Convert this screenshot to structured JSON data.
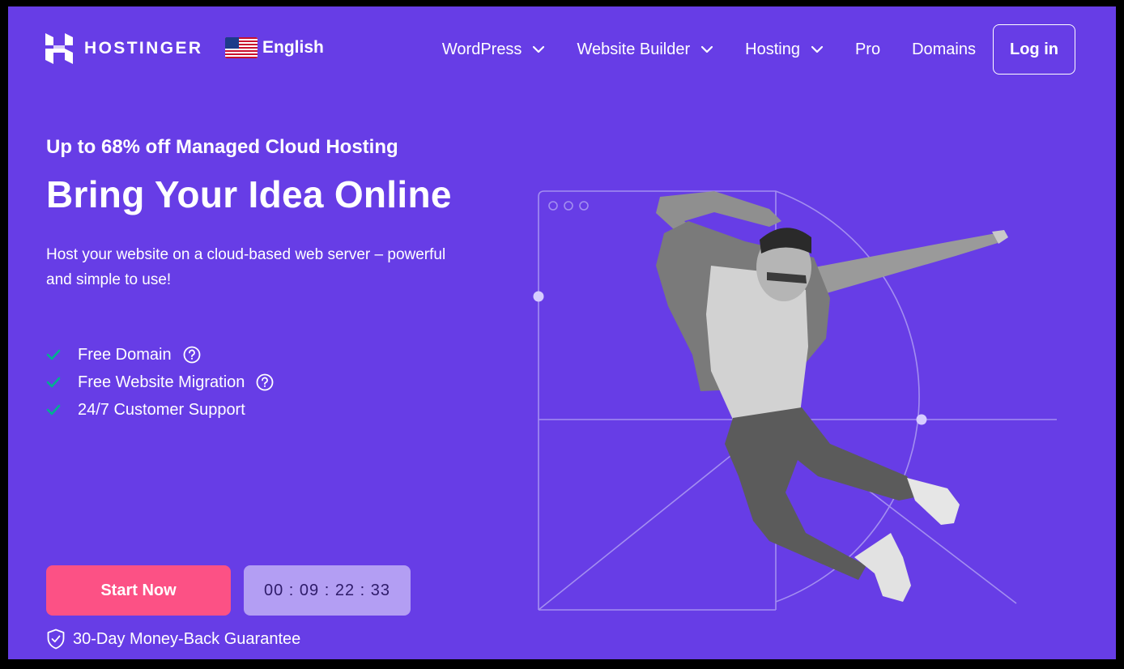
{
  "brand": {
    "name": "HOSTINGER",
    "logo_icon": "hostinger-h-logo"
  },
  "language": {
    "label": "English",
    "flag_icon": "us-flag-icon"
  },
  "nav": {
    "items": [
      {
        "label": "WordPress",
        "has_dropdown": true
      },
      {
        "label": "Website Builder",
        "has_dropdown": true
      },
      {
        "label": "Hosting",
        "has_dropdown": true
      },
      {
        "label": "Pro",
        "has_dropdown": false
      },
      {
        "label": "Domains",
        "has_dropdown": false
      }
    ],
    "login_label": "Log in"
  },
  "hero": {
    "promo": "Up to 68% off Managed Cloud Hosting",
    "headline": "Bring Your Idea Online",
    "description": "Host your website on a cloud-based web server – powerful and simple to use!",
    "features": [
      {
        "label": "Free Domain",
        "has_help": true
      },
      {
        "label": "Free Website Migration",
        "has_help": true
      },
      {
        "label": "24/7 Customer Support",
        "has_help": false
      }
    ],
    "cta_label": "Start Now",
    "countdown": "00 : 09 : 22 : 33",
    "guarantee": "30-Day Money-Back Guarantee"
  },
  "colors": {
    "background": "#673de6",
    "cta": "#fc5185",
    "timer_bg": "#b39ef3",
    "check": "#00b090",
    "text": "#ffffff"
  }
}
